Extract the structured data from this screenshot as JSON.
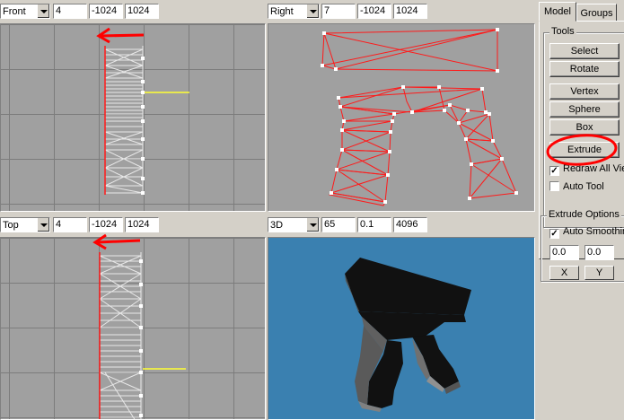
{
  "viewports": [
    {
      "view": "Front",
      "grid": "4",
      "min": "-1024",
      "max": "1024"
    },
    {
      "view": "Right",
      "grid": "7",
      "min": "-1024",
      "max": "1024"
    },
    {
      "view": "Top",
      "grid": "4",
      "min": "-1024",
      "max": "1024"
    },
    {
      "view": "3D",
      "grid": "65",
      "min": "0.1",
      "max": "4096"
    }
  ],
  "panel": {
    "tabs": [
      "Model",
      "Groups"
    ],
    "tools_title": "Tools",
    "buttons": {
      "select": "Select",
      "rotate": "Rotate",
      "vertex": "Vertex",
      "sphere": "Sphere",
      "box": "Box",
      "extrude": "Extrude"
    },
    "redraw_all": "Redraw All Views",
    "auto_tool": "Auto Tool",
    "extrude_title": "Extrude Options",
    "auto_smoothing": "Auto Smoothing",
    "field1": "0.0",
    "field2": "0.0",
    "axis_x": "X",
    "axis_y": "Y"
  },
  "colors": {
    "wireframe": "#ff1a1a",
    "selection": "#e8e8e8",
    "axis_highlight": "#ffff33",
    "view3d_bg": "#3a80b0",
    "annotation": "#ff0000"
  }
}
